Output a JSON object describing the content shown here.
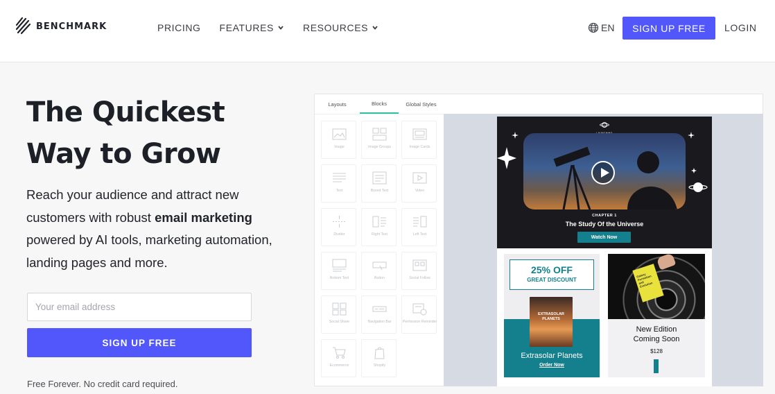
{
  "header": {
    "brand": "BENCHMARK",
    "nav": [
      {
        "label": "PRICING",
        "has_dropdown": false
      },
      {
        "label": "FEATURES",
        "has_dropdown": true
      },
      {
        "label": "RESOURCES",
        "has_dropdown": true
      }
    ],
    "language": "EN",
    "signup_label": "SIGN UP FREE",
    "login_label": "LOGIN"
  },
  "hero": {
    "headline_line1": "The Quickest",
    "headline_line2": "Way to Grow",
    "sub_part1": "Reach your audience and attract new customers with robust ",
    "sub_bold": "email marketing",
    "sub_part2": " powered by AI tools, marketing automation, landing pages and more.",
    "email_placeholder": "Your email address",
    "signup_label": "SIGN UP FREE",
    "note": "Free Forever. No credit card required."
  },
  "editor": {
    "tabs": [
      {
        "label": "Layouts",
        "active": false
      },
      {
        "label": "Blocks",
        "active": true
      },
      {
        "label": "Global Styles",
        "active": false
      }
    ],
    "blocks": [
      {
        "label": "Image",
        "icon": "image-icon"
      },
      {
        "label": "Image Groups",
        "icon": "image-group-icon"
      },
      {
        "label": "Image Cards",
        "icon": "image-card-icon"
      },
      {
        "label": "Text",
        "icon": "text-icon"
      },
      {
        "label": "Boxed Text",
        "icon": "boxed-text-icon"
      },
      {
        "label": "Video",
        "icon": "video-icon"
      },
      {
        "label": "Divider",
        "icon": "divider-icon"
      },
      {
        "label": "Right Text",
        "icon": "right-text-icon"
      },
      {
        "label": "Left Text",
        "icon": "left-text-icon"
      },
      {
        "label": "Bottom Text",
        "icon": "bottom-text-icon"
      },
      {
        "label": "Button",
        "icon": "button-icon"
      },
      {
        "label": "Social Follow",
        "icon": "social-follow-icon"
      },
      {
        "label": "Social Share",
        "icon": "social-share-icon"
      },
      {
        "label": "Navigation Bar",
        "icon": "navigation-bar-icon"
      },
      {
        "label": "Permission Reminder",
        "icon": "permission-reminder-icon"
      },
      {
        "label": "Ecommerce",
        "icon": "cart-icon"
      },
      {
        "label": "Shopify",
        "icon": "shopify-icon"
      }
    ],
    "email": {
      "logo_text": "LAUNCHING SPACE",
      "chapter": "CHAPTER 1",
      "title": "The Study Of the Universe",
      "watch_label": "Watch Now",
      "discount_big": "25% OFF",
      "discount_small": "GREAT DISCOUNT",
      "book_title": "EXTRASOLAR PLANETS",
      "product1_title": "Extrasolar Planets",
      "product1_cta": "Order Now",
      "book2_text": "Galaxy Formation and Evolution",
      "product2_line1": "New Edition",
      "product2_line2": "Coming Soon",
      "product2_price": "$128"
    }
  }
}
